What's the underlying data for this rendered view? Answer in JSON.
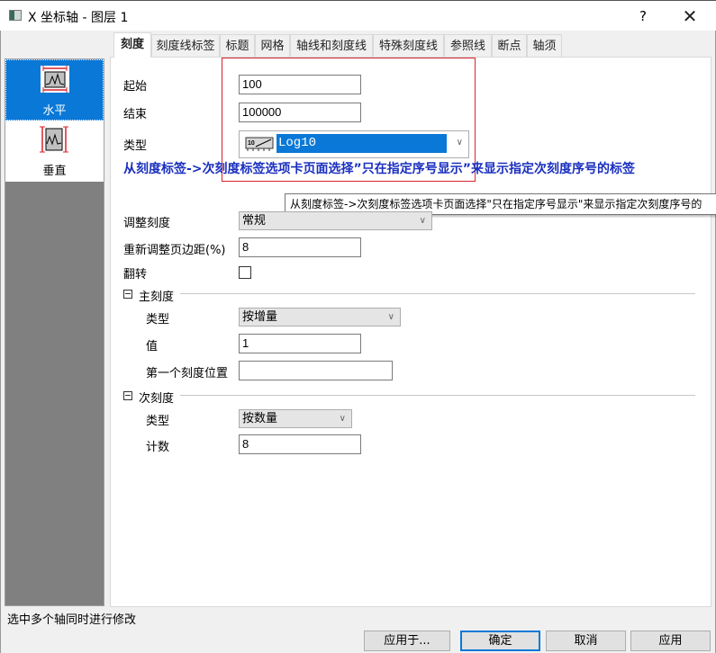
{
  "window": {
    "title": "X 坐标轴 - 图层 1",
    "help_label": "?",
    "close_label": "✕"
  },
  "sidebar": {
    "items": [
      {
        "label": "水平",
        "icon": "horizontal-axis-icon",
        "selected": true
      },
      {
        "label": "垂直",
        "icon": "vertical-axis-icon",
        "selected": false
      }
    ]
  },
  "tabs": [
    {
      "label": "刻度",
      "active": true
    },
    {
      "label": "刻度线标签"
    },
    {
      "label": "标题"
    },
    {
      "label": "网格"
    },
    {
      "label": "轴线和刻度线"
    },
    {
      "label": "特殊刻度线"
    },
    {
      "label": "参照线"
    },
    {
      "label": "断点"
    },
    {
      "label": "轴须"
    }
  ],
  "scale": {
    "from_label": "起始",
    "from_value": "100",
    "to_label": "结束",
    "to_value": "100000",
    "type_label": "类型",
    "type_value": "Log10",
    "type_icon": "log10-scale-icon"
  },
  "hint_text": "从刻度标签->次刻度标签选项卡页面选择”只在指定序号显示”来显示指定次刻度序号的标签",
  "tooltip_text": "从刻度标签->次刻度标签选项卡页面选择\"只在指定序号显示\"来显示指定次刻度序号的",
  "rescale": {
    "label": "调整刻度",
    "value": "常规"
  },
  "rescale_margin": {
    "label": "重新调整页边距(%)",
    "value": "8"
  },
  "reverse": {
    "label": "翻转",
    "checked": false
  },
  "major_ticks": {
    "group_label": "主刻度",
    "type_label": "类型",
    "type_value": "按增量",
    "value_label": "值",
    "value": "1",
    "first_tick_label": "第一个刻度位置",
    "first_tick_value": ""
  },
  "minor_ticks": {
    "group_label": "次刻度",
    "type_label": "类型",
    "type_value": "按数量",
    "count_label": "计数",
    "count_value": "8"
  },
  "status_text": "选中多个轴同时进行修改",
  "buttons": {
    "apply_to": "应用于...",
    "ok": "确定",
    "cancel": "取消",
    "apply": "应用"
  },
  "colors": {
    "selection": "#0a78d7",
    "hint_text": "#1a2fbf",
    "highlight_box": "#d9232e"
  }
}
